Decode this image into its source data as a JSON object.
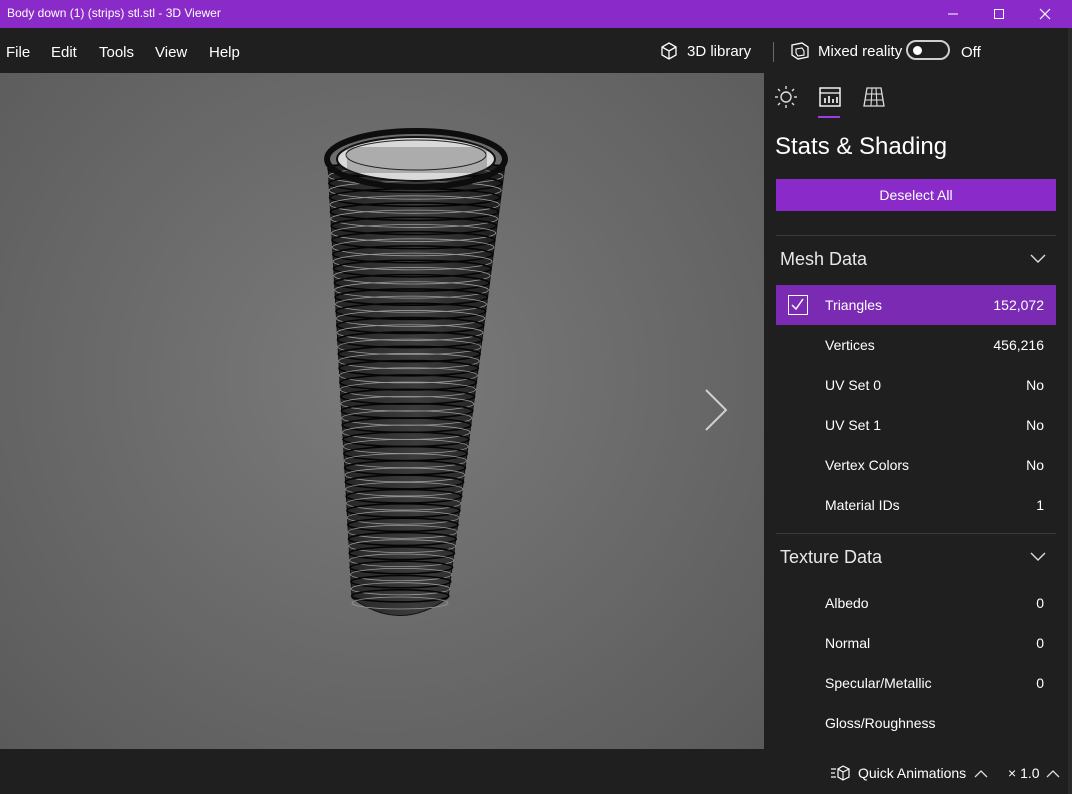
{
  "window": {
    "title": "Body down (1) (strips) stl.stl - 3D Viewer"
  },
  "menu": {
    "items": [
      "File",
      "Edit",
      "Tools",
      "View",
      "Help"
    ],
    "library_label": "3D library",
    "mixed_reality_label": "Mixed reality",
    "toggle_state": "Off",
    "toggle_on": false
  },
  "panel": {
    "title": "Stats & Shading",
    "deselect_label": "Deselect All",
    "active_tab": "stats",
    "tab_icons": [
      "sun-icon",
      "stats-chart-icon",
      "grid-icon"
    ],
    "mesh_section": {
      "title": "Mesh Data",
      "rows": [
        {
          "label": "Triangles",
          "value": "152,072",
          "selected": true
        },
        {
          "label": "Vertices",
          "value": "456,216"
        },
        {
          "label": "UV Set 0",
          "value": "No"
        },
        {
          "label": "UV Set 1",
          "value": "No"
        },
        {
          "label": "Vertex Colors",
          "value": "No"
        },
        {
          "label": "Material IDs",
          "value": "1"
        }
      ]
    },
    "texture_section": {
      "title": "Texture Data",
      "rows": [
        {
          "label": "Albedo",
          "value": "0"
        },
        {
          "label": "Normal",
          "value": "0"
        },
        {
          "label": "Specular/Metallic",
          "value": "0"
        },
        {
          "label": "Gloss/Roughness",
          "value": ""
        }
      ]
    }
  },
  "bottom": {
    "quick_animations_label": "Quick Animations",
    "speed_label": "× 1.0"
  },
  "colors": {
    "accent": "#8a2bc9",
    "selected_row": "#7a2ab3",
    "background": "#1f1f1f",
    "viewport": "#6e6e6e"
  }
}
